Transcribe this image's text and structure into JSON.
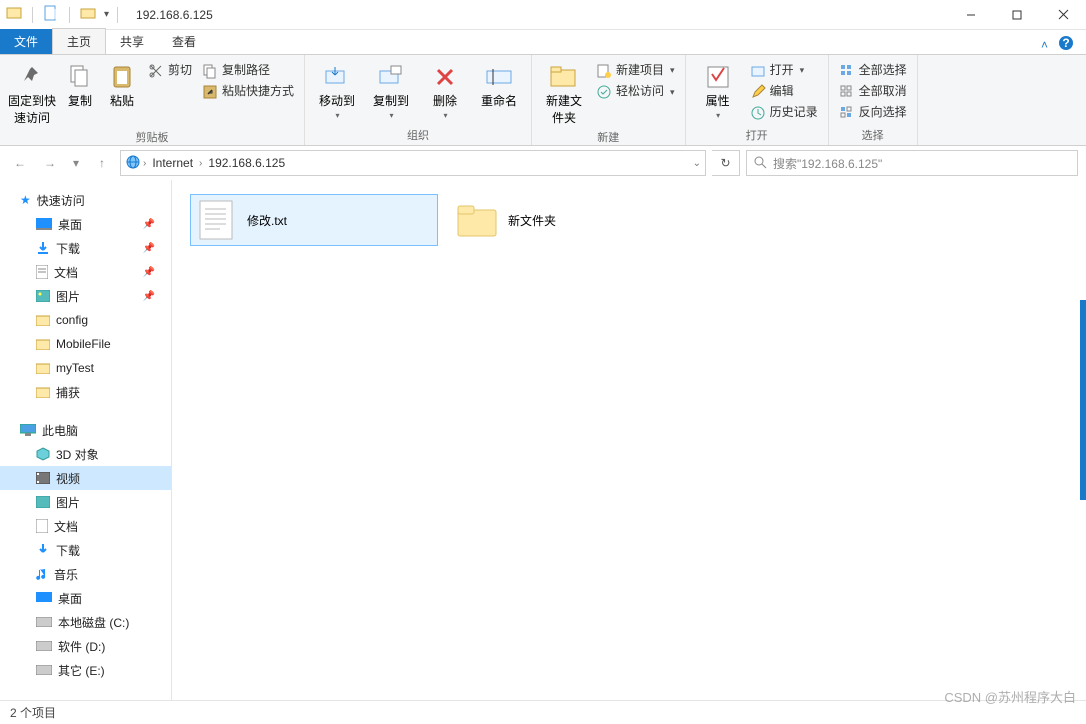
{
  "window": {
    "title": "192.168.6.125"
  },
  "tabs": {
    "file": "文件",
    "home": "主页",
    "share": "共享",
    "view": "查看"
  },
  "ribbon": {
    "pin": "固定到快速访问",
    "copy": "复制",
    "paste": "粘贴",
    "cut": "剪切",
    "copypath": "复制路径",
    "pasteshortcut": "粘贴快捷方式",
    "group_clipboard": "剪贴板",
    "moveto": "移动到",
    "copyto": "复制到",
    "delete": "删除",
    "rename": "重命名",
    "group_organize": "组织",
    "newfolder": "新建文件夹",
    "newitem": "新建项目",
    "easyaccess": "轻松访问",
    "group_new": "新建",
    "properties": "属性",
    "open": "打开",
    "edit": "编辑",
    "history": "历史记录",
    "group_open": "打开",
    "selectall": "全部选择",
    "selectnone": "全部取消",
    "invert": "反向选择",
    "group_select": "选择"
  },
  "address": {
    "crumb1": "Internet",
    "crumb2": "192.168.6.125",
    "search_placeholder": "搜索\"192.168.6.125\""
  },
  "sidebar": {
    "quick": "快速访问",
    "desktop": "桌面",
    "downloads": "下载",
    "documents": "文档",
    "pictures": "图片",
    "config": "config",
    "mobilefile": "MobileFile",
    "mytest": "myTest",
    "capture": "捕获",
    "thispc": "此电脑",
    "obj3d": "3D 对象",
    "videos": "视频",
    "pictures2": "图片",
    "documents2": "文档",
    "downloads2": "下载",
    "music": "音乐",
    "desktop2": "桌面",
    "diskc": "本地磁盘 (C:)",
    "diskd": "软件 (D:)",
    "diske": "其它 (E:)"
  },
  "files": {
    "item1": "修改.txt",
    "item2": "新文件夹"
  },
  "status": {
    "count": "2 个项目"
  },
  "watermark": "CSDN @苏州程序大白"
}
